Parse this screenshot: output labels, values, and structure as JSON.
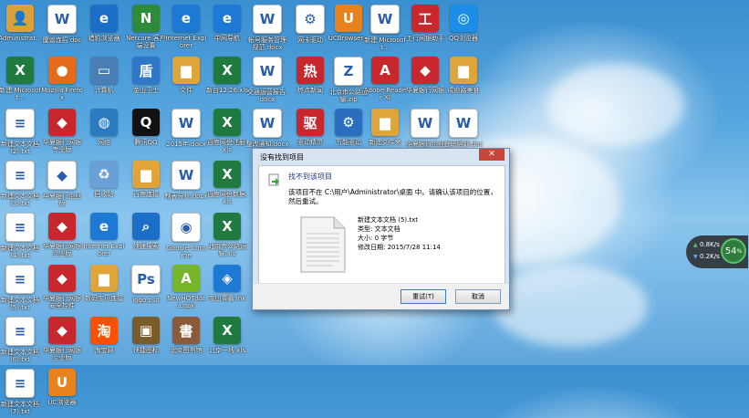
{
  "desktop": {
    "columns": [
      [
        {
          "label": "Administrat...",
          "icon": "user-folder-icon",
          "color": "#d9a23a"
        },
        {
          "label": "新建 Microsoft...",
          "icon": "excel-icon",
          "color": "#1f7a3f"
        },
        {
          "label": "新建文本文档 (2).txt",
          "icon": "text-file-icon",
          "color": "#ffffff"
        },
        {
          "label": "新建文本文档 (3).txt",
          "icon": "text-file-icon",
          "color": "#ffffff"
        },
        {
          "label": "新建文本文档 (4).txt",
          "icon": "text-file-icon",
          "color": "#ffffff"
        },
        {
          "label": "新建文本文档 (5).txt",
          "icon": "text-file-icon",
          "color": "#ffffff"
        },
        {
          "label": "新建文本文档 (6).txt",
          "icon": "text-file-icon",
          "color": "#ffffff"
        },
        {
          "label": "新建文本文档 (7).txt",
          "icon": "text-file-icon",
          "color": "#ffffff"
        }
      ],
      [
        {
          "label": "魔兽连招.doc",
          "icon": "word-icon",
          "color": "#ffffff"
        },
        {
          "label": "Mozilla Firefox",
          "icon": "firefox-icon",
          "color": "#e66a1c"
        },
        {
          "label": "华夏银行网银专业版",
          "icon": "bank-icon",
          "color": "#c8282d"
        },
        {
          "label": "华夏银行企业版",
          "icon": "bank-icon",
          "color": "#ffffff"
        },
        {
          "label": "华夏银行网银企业版",
          "icon": "bank-icon",
          "color": "#c8282d"
        },
        {
          "label": "华夏银行网银安全控件",
          "icon": "bank-icon",
          "color": "#c8282d"
        },
        {
          "label": "华夏银行网银企业版",
          "icon": "bank-icon",
          "color": "#c8282d"
        },
        {
          "label": "UC浏览器",
          "icon": "uc-browser-icon",
          "color": "#e8821e"
        }
      ],
      [
        {
          "label": "猎豹浏览器",
          "icon": "browser-icon",
          "color": "#1c6fc7"
        },
        {
          "label": "计算机",
          "icon": "computer-icon",
          "color": "#4a7fb5"
        },
        {
          "label": "网络",
          "icon": "network-icon",
          "color": "#2b7bc0"
        },
        {
          "label": "回收站",
          "icon": "recycle-bin-icon",
          "color": "#6aa0d8"
        },
        {
          "label": "Internet Explorer",
          "icon": "ie-icon",
          "color": "#1c7ad4"
        },
        {
          "label": "数码宝贝连接",
          "icon": "folder-icon",
          "color": "#e0a53a"
        },
        {
          "label": "淘宝网",
          "icon": "taobao-icon",
          "color": "#ff5000"
        }
      ],
      [
        {
          "label": "Netcore 客户端设置",
          "icon": "netcore-icon",
          "color": "#2e8b3a"
        },
        {
          "label": "金山卫士",
          "icon": "guard-icon",
          "color": "#2f78c8"
        },
        {
          "label": "腾讯QQ",
          "icon": "qq-icon",
          "color": "#111111"
        },
        {
          "label": "百度连接",
          "icon": "folder-icon",
          "color": "#e0a53a"
        },
        {
          "label": "快速搜索",
          "icon": "search-icon",
          "color": "#1c6fc7"
        },
        {
          "label": "logo.psd",
          "icon": "psd-icon",
          "color": "#ffffff"
        },
        {
          "label": "快捷图标",
          "icon": "image-icon",
          "color": "#7a5b2a"
        }
      ],
      [
        {
          "label": "Internet Explorer",
          "icon": "ie-icon",
          "color": "#1c7ad4"
        },
        {
          "label": "文件",
          "icon": "folder-icon",
          "color": "#e0a53a"
        },
        {
          "label": "2015年.docx",
          "icon": "word-icon",
          "color": "#ffffff"
        },
        {
          "label": "制表分析.docx",
          "icon": "word-icon",
          "color": "#ffffff"
        },
        {
          "label": "Google Chrome",
          "icon": "chrome-icon",
          "color": "#ffffff"
        },
        {
          "label": "NewHOTdata.apk",
          "icon": "apk-icon",
          "color": "#76b72a"
        },
        {
          "label": "北京图书馆",
          "icon": "library-icon",
          "color": "#8a5a3a"
        }
      ],
      [
        {
          "label": "中网导航",
          "icon": "navigation-icon",
          "color": "#1c7ad4"
        },
        {
          "label": "新台12.26.xls",
          "icon": "excel-icon",
          "color": "#1f7a3f"
        },
        {
          "label": "百度网盘注册.xls",
          "icon": "excel-icon",
          "color": "#1f7a3f"
        },
        {
          "label": "百度网盘数据.xls",
          "icon": "excel-icon",
          "color": "#1f7a3f"
        },
        {
          "label": "北京市公路运输.xls",
          "icon": "excel-icon",
          "color": "#1f7a3f"
        },
        {
          "label": "金山毒霸.lnk",
          "icon": "shield-icon",
          "color": "#1c7ad4"
        },
        {
          "label": "北京一线.xls",
          "icon": "excel-icon",
          "color": "#1f7a3f"
        }
      ],
      [
        {
          "label": "帐号服务管理规范.docx",
          "icon": "word-icon",
          "color": "#ffffff"
        },
        {
          "label": "交通运营报告.docx",
          "icon": "word-icon",
          "color": "#ffffff"
        },
        {
          "label": "整改通知.docx",
          "icon": "word-icon",
          "color": "#ffffff"
        }
      ],
      [
        {
          "label": "网卡驱动",
          "icon": "driver-icon",
          "color": "#ffffff"
        },
        {
          "label": "热点新闻",
          "icon": "news-icon",
          "color": "#c8282d"
        },
        {
          "label": "驱动精灵",
          "icon": "driver-wizard-icon",
          "color": "#c8282d"
        },
        {
          "label": "微信",
          "icon": "wechat-icon",
          "color": "#3cb034"
        }
      ],
      [
        {
          "label": "UCBrowser...",
          "icon": "uc-browser-icon",
          "color": "#e8821e"
        },
        {
          "label": "北京市公路运输.zip",
          "icon": "zip-icon",
          "color": "#ffffff"
        },
        {
          "label": "万能驱动",
          "icon": "driver-icon",
          "color": "#2a6fbf"
        },
        {
          "label": "QQ截图2015.png",
          "icon": "image-icon",
          "color": "#ffffff"
        }
      ],
      [
        {
          "label": "新建 Microsoft...",
          "icon": "word-icon",
          "color": "#ffffff"
        },
        {
          "label": "Adobe Reader XI",
          "icon": "pdf-icon",
          "color": "#c8282d"
        },
        {
          "label": "新建文件夹",
          "icon": "folder-icon",
          "color": "#e0a53a"
        },
        {
          "label": "北京人口调查.docx",
          "icon": "word-icon",
          "color": "#ffffff"
        }
      ],
      [
        {
          "label": "工行网银助手",
          "icon": "icbc-icon",
          "color": "#c8282d"
        },
        {
          "label": "华夏银行网银",
          "icon": "bank-icon",
          "color": "#c8282d"
        },
        {
          "label": "华夏银行企业版",
          "icon": "word-icon",
          "color": "#ffffff"
        },
        {
          "label": "流动.doc",
          "icon": "word-icon",
          "color": "#ffffff"
        }
      ],
      [
        {
          "label": "QQ浏览器",
          "icon": "qq-browser-icon",
          "color": "#1c8ee6"
        },
        {
          "label": "成府路美食",
          "icon": "folder-icon",
          "color": "#e0a53a"
        },
        {
          "label": "在职培训.doc",
          "icon": "word-icon",
          "color": "#ffffff"
        }
      ]
    ]
  },
  "dialog": {
    "title": "没有找到项目",
    "close_label": "✕",
    "heading": "找不到该项目",
    "message": "该项目不在 C:\\用户\\Administrator\\桌面 中。请确认该项目的位置，然后重试。",
    "file_name": "新建文本文档 (5).txt",
    "file_type": "类型: 文本文档",
    "file_size": "大小: 0 字节",
    "file_modified": "修改日期: 2015/7/28 11:14",
    "retry_label": "重试(T)",
    "cancel_label": "取消"
  },
  "network_widget": {
    "upload": "0.8K/s",
    "download": "0.2K/s",
    "percent": "54",
    "percent_sign": "%"
  }
}
